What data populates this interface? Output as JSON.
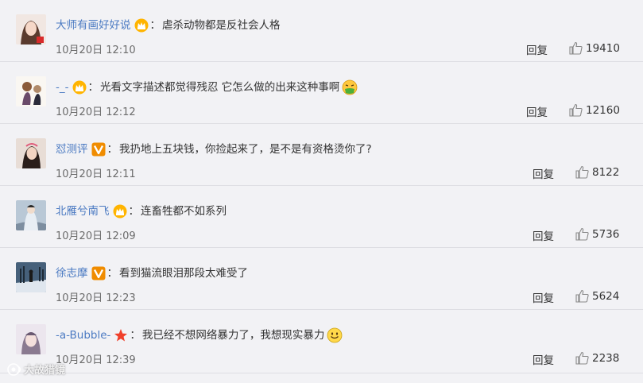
{
  "comments": [
    {
      "username": "大师有画好好说",
      "badge": "crown-badge",
      "text": "虐杀动物都是反社会人格",
      "emoji": "",
      "time": "10月20日 12:10",
      "reply": "回复",
      "likes": "19410"
    },
    {
      "username": "-_-",
      "badge": "crown-badge",
      "text": "光看文字描述都觉得残忍 它怎么做的出来这种事啊",
      "emoji": "vomit-emoji",
      "time": "10月20日 12:12",
      "reply": "回复",
      "likes": "12160"
    },
    {
      "username": "怼测评",
      "badge": "verified-v-badge",
      "text": "我扔地上五块钱，你捡起来了，是不是有资格烫你了?",
      "emoji": "",
      "time": "10月20日 12:11",
      "reply": "回复",
      "likes": "8122"
    },
    {
      "username": "北雁兮南飞",
      "badge": "crown-badge",
      "text": "连畜牲都不如系列",
      "emoji": "",
      "time": "10月20日 12:09",
      "reply": "回复",
      "likes": "5736"
    },
    {
      "username": "徐志摩",
      "badge": "verified-v-badge",
      "text": "看到猫流眼泪那段太难受了",
      "emoji": "",
      "time": "10月20日 12:23",
      "reply": "回复",
      "likes": "5624"
    },
    {
      "username": "-a-Bubble-",
      "badge": "star-badge",
      "text": "我已经不想网络暴力了，我想现实暴力",
      "emoji": "smile-emoji",
      "time": "10月20日 12:39",
      "reply": "回复",
      "likes": "2238"
    }
  ],
  "watermark": "大故猎镜",
  "colors": {
    "username": "#4b7ac2",
    "background": "#f2f2f5",
    "divider": "#dedee3",
    "v_badge": "#f08c00",
    "crown": "#f0a000"
  }
}
